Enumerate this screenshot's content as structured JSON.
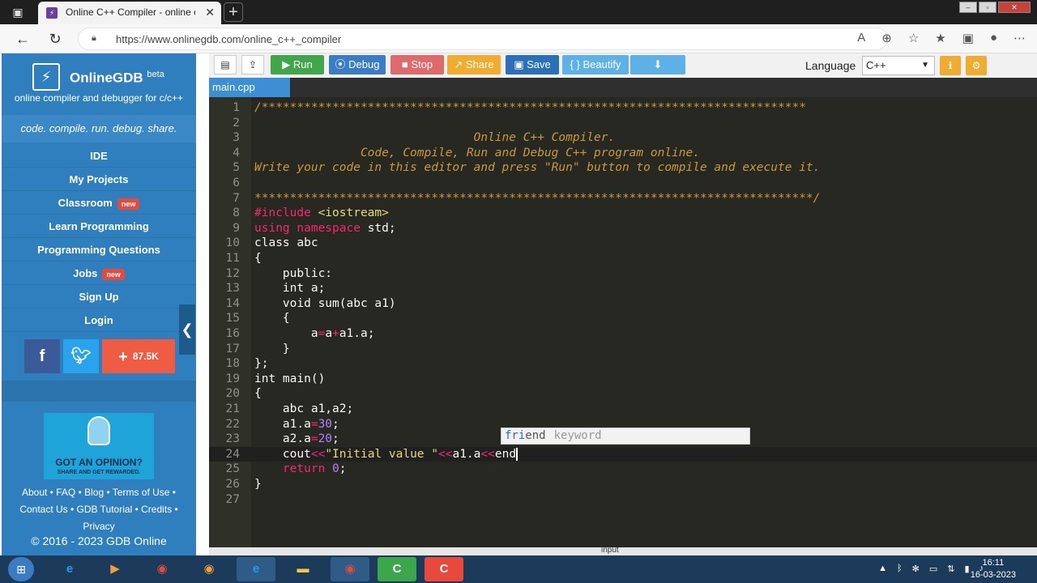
{
  "browser": {
    "tab_title": "Online C++ Compiler - online ed",
    "url": "https://www.onlinegdb.com/online_c++_compiler",
    "favicon": "OnlineGDB-icon"
  },
  "sidebar": {
    "brand": "OnlineGDB",
    "brand_sup": "beta",
    "tagline": "online compiler and debugger for c/c++",
    "motto": "code. compile. run. debug. share.",
    "nav": [
      {
        "label": "IDE",
        "badge": ""
      },
      {
        "label": "My Projects",
        "badge": ""
      },
      {
        "label": "Classroom",
        "badge": "new"
      },
      {
        "label": "Learn Programming",
        "badge": ""
      },
      {
        "label": "Programming Questions",
        "badge": ""
      },
      {
        "label": "Jobs",
        "badge": "new"
      },
      {
        "label": "Sign Up",
        "badge": ""
      },
      {
        "label": "Login",
        "badge": ""
      }
    ],
    "share_count": "87.5K",
    "ad_title": "GOT AN OPINION?",
    "ad_sub": "SHARE AND GET REWARDED.",
    "footer": {
      "about": "About",
      "faq": "FAQ",
      "blog": "Blog",
      "terms": "Terms of Use",
      "contact": "Contact Us",
      "tutorial": "GDB Tutorial",
      "credits": "Credits",
      "privacy": "Privacy"
    },
    "copyright": "© 2016 - 2023 GDB Online"
  },
  "toolbar": {
    "run": "Run",
    "debug": "Debug",
    "stop": "Stop",
    "share": "Share",
    "save": "Save",
    "beautify": "{ } Beautify",
    "language_label": "Language",
    "language_value": "C++"
  },
  "editor": {
    "file_tab": "main.cpp",
    "active_line": 24,
    "autocomplete": {
      "match": "fri",
      "rest": "end",
      "meta": "keyword"
    }
  },
  "statusbar": {
    "input_label": "input"
  },
  "taskbar": {
    "time": "16:11",
    "date": "16-03-2023"
  },
  "colors": {
    "sidebar": "#2f7fbf",
    "run": "#3fa74a",
    "debug": "#3b7dc4",
    "stop": "#e06a6a",
    "share": "#f0ac2e",
    "save": "#2a70b8",
    "beautify": "#5eb1e6",
    "editor_bg": "#272822"
  }
}
